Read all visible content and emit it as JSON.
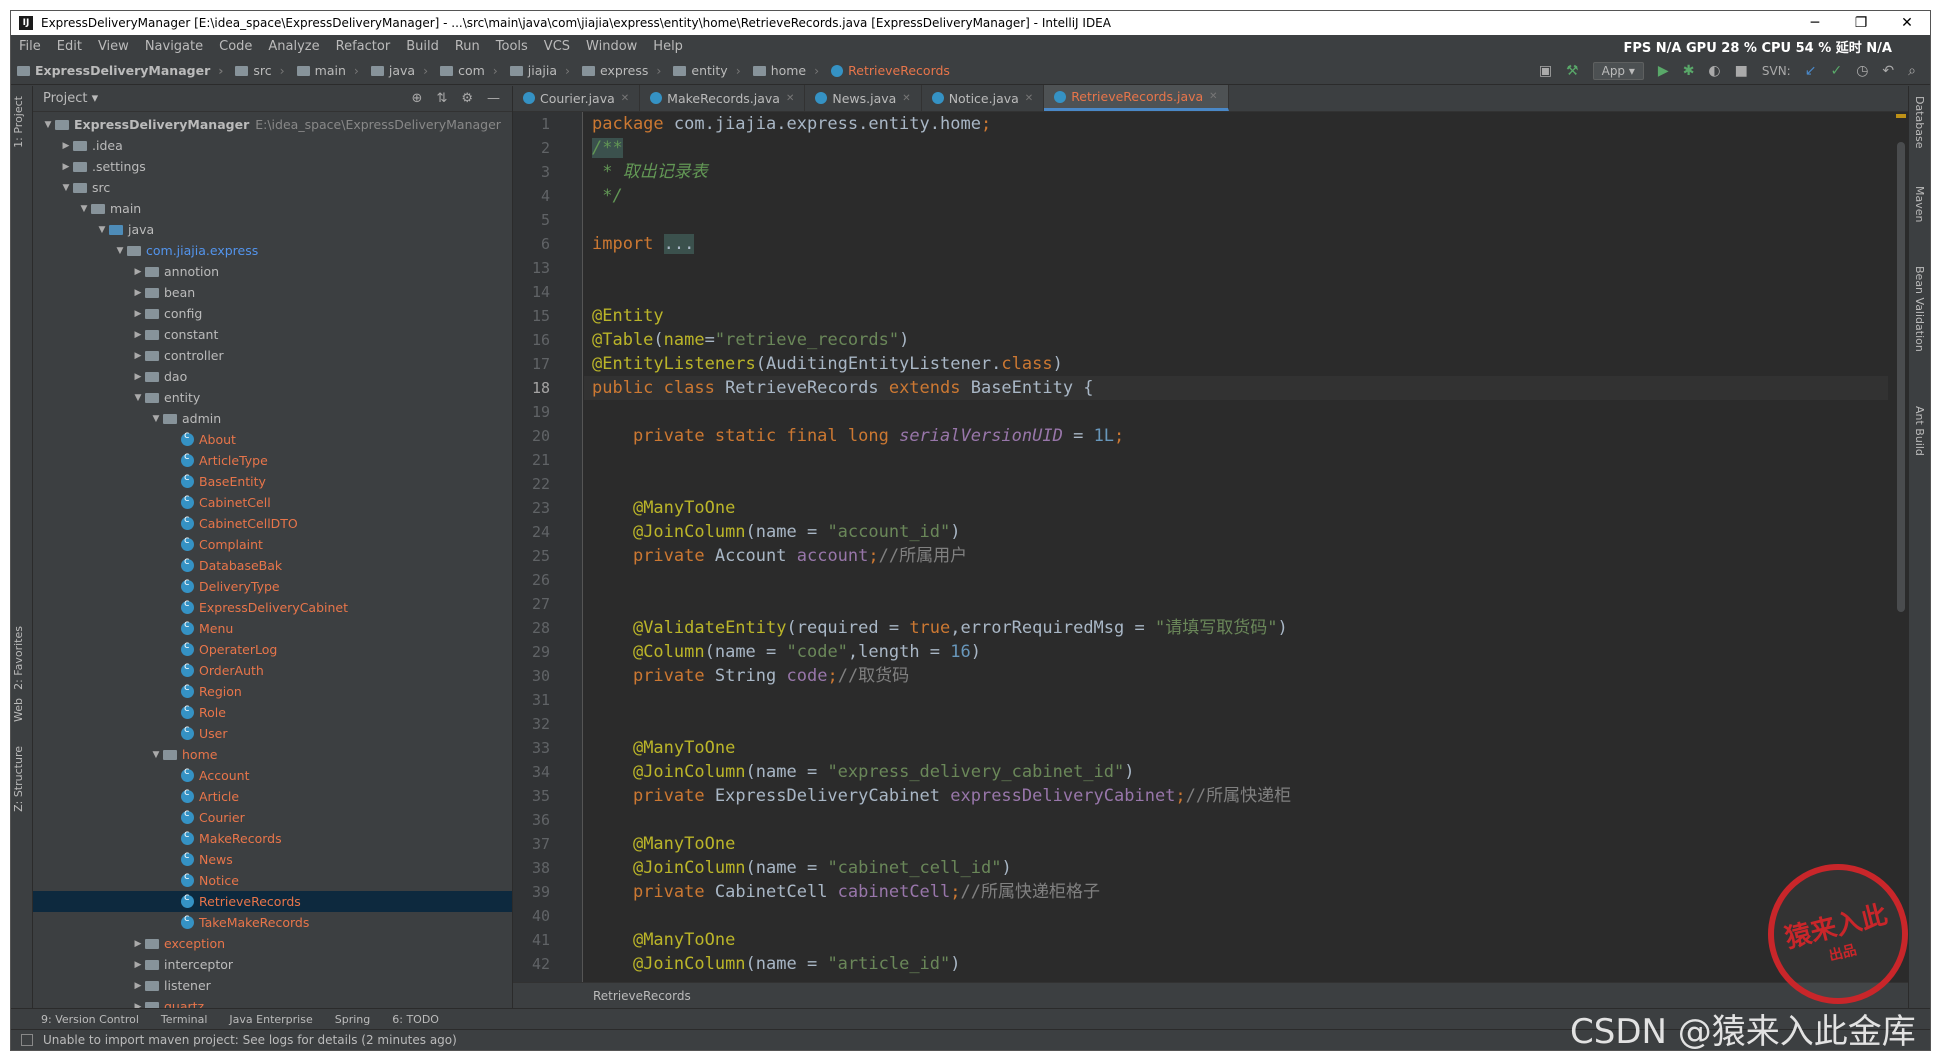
{
  "title_bar": {
    "title": "ExpressDeliveryManager [E:\\idea_space\\ExpressDeliveryManager] - ...\\src\\main\\java\\com\\jiajia\\express\\entity\\home\\RetrieveRecords.java [ExpressDeliveryManager] - IntelliJ IDEA",
    "minimize": "─",
    "maximize": "❐",
    "close": "✕"
  },
  "menu": [
    "File",
    "Edit",
    "View",
    "Navigate",
    "Code",
    "Analyze",
    "Refactor",
    "Build",
    "Run",
    "Tools",
    "VCS",
    "Window",
    "Help"
  ],
  "perf_overlay": "FPS N/A GPU 28 % CPU 54 % 延时 N/A",
  "nav": {
    "crumbs": [
      "ExpressDeliveryManager",
      "src",
      "main",
      "java",
      "com",
      "jiajia",
      "express",
      "entity",
      "home"
    ],
    "active_crumb": "RetrieveRecords",
    "run_config": "App",
    "svn_label": "SVN:"
  },
  "left_strip": {
    "project": "1: Project",
    "favorites": "2: Favorites",
    "web": "Web",
    "structure": "Z: Structure"
  },
  "right_strip": {
    "database": "Database",
    "maven": "Maven",
    "bean_validation": "Bean Validation",
    "ant_build": "Ant Build"
  },
  "project_panel": {
    "header": "Project",
    "tree": [
      {
        "depth": 0,
        "type": "folder",
        "label": "ExpressDeliveryManager",
        "hint": "E:\\idea_space\\ExpressDeliveryManager",
        "open": true,
        "bold": true
      },
      {
        "depth": 1,
        "type": "folder",
        "label": ".idea",
        "open": false
      },
      {
        "depth": 1,
        "type": "folder",
        "label": ".settings",
        "open": false
      },
      {
        "depth": 1,
        "type": "folder",
        "label": "src",
        "open": true
      },
      {
        "depth": 2,
        "type": "folder",
        "label": "main",
        "open": true
      },
      {
        "depth": 3,
        "type": "srcfolder",
        "label": "java",
        "open": true
      },
      {
        "depth": 4,
        "type": "folder",
        "label": "com.jiajia.express",
        "open": true,
        "color": "blue"
      },
      {
        "depth": 5,
        "type": "folder",
        "label": "annotion",
        "open": false
      },
      {
        "depth": 5,
        "type": "folder",
        "label": "bean",
        "open": false
      },
      {
        "depth": 5,
        "type": "folder",
        "label": "config",
        "open": false
      },
      {
        "depth": 5,
        "type": "folder",
        "label": "constant",
        "open": false
      },
      {
        "depth": 5,
        "type": "folder",
        "label": "controller",
        "open": false
      },
      {
        "depth": 5,
        "type": "folder",
        "label": "dao",
        "open": false
      },
      {
        "depth": 5,
        "type": "folder",
        "label": "entity",
        "open": true
      },
      {
        "depth": 6,
        "type": "folder",
        "label": "admin",
        "open": true
      },
      {
        "depth": 7,
        "type": "class",
        "label": "About"
      },
      {
        "depth": 7,
        "type": "class",
        "label": "ArticleType"
      },
      {
        "depth": 7,
        "type": "class",
        "label": "BaseEntity"
      },
      {
        "depth": 7,
        "type": "class",
        "label": "CabinetCell"
      },
      {
        "depth": 7,
        "type": "class",
        "label": "CabinetCellDTO"
      },
      {
        "depth": 7,
        "type": "class",
        "label": "Complaint"
      },
      {
        "depth": 7,
        "type": "class",
        "label": "DatabaseBak"
      },
      {
        "depth": 7,
        "type": "class",
        "label": "DeliveryType"
      },
      {
        "depth": 7,
        "type": "class",
        "label": "ExpressDeliveryCabinet"
      },
      {
        "depth": 7,
        "type": "class",
        "label": "Menu"
      },
      {
        "depth": 7,
        "type": "class",
        "label": "OperaterLog"
      },
      {
        "depth": 7,
        "type": "class",
        "label": "OrderAuth"
      },
      {
        "depth": 7,
        "type": "class",
        "label": "Region"
      },
      {
        "depth": 7,
        "type": "class",
        "label": "Role"
      },
      {
        "depth": 7,
        "type": "class",
        "label": "User"
      },
      {
        "depth": 6,
        "type": "folder",
        "label": "home",
        "open": true,
        "color": "orange"
      },
      {
        "depth": 7,
        "type": "class",
        "label": "Account"
      },
      {
        "depth": 7,
        "type": "class",
        "label": "Article"
      },
      {
        "depth": 7,
        "type": "class",
        "label": "Courier"
      },
      {
        "depth": 7,
        "type": "class",
        "label": "MakeRecords"
      },
      {
        "depth": 7,
        "type": "class",
        "label": "News"
      },
      {
        "depth": 7,
        "type": "class",
        "label": "Notice"
      },
      {
        "depth": 7,
        "type": "class",
        "label": "RetrieveRecords",
        "selected": true
      },
      {
        "depth": 7,
        "type": "class",
        "label": "TakeMakeRecords"
      },
      {
        "depth": 5,
        "type": "folder",
        "label": "exception",
        "open": false,
        "color": "orange"
      },
      {
        "depth": 5,
        "type": "folder",
        "label": "interceptor",
        "open": false
      },
      {
        "depth": 5,
        "type": "folder",
        "label": "listener",
        "open": false
      },
      {
        "depth": 5,
        "type": "folder",
        "label": "quartz",
        "open": false,
        "color": "orange"
      }
    ]
  },
  "editor": {
    "tabs": [
      {
        "label": "Courier.java",
        "active": false
      },
      {
        "label": "MakeRecords.java",
        "active": false
      },
      {
        "label": "News.java",
        "active": false
      },
      {
        "label": "Notice.java",
        "active": false
      },
      {
        "label": "RetrieveRecords.java",
        "active": true
      }
    ],
    "lines": [
      {
        "n": "1",
        "html": "<span class='kw'>package</span> com.jiajia.express.entity.home<span class='kw'>;</span>"
      },
      {
        "n": "2",
        "html": "<span class='doc fold'>/**</span>"
      },
      {
        "n": "3",
        "html": "<span class='doc'> * 取出记录表</span>"
      },
      {
        "n": "4",
        "html": "<span class='doc'> */</span>"
      },
      {
        "n": "5",
        "html": ""
      },
      {
        "n": "6",
        "html": "<span class='kw'>import</span> <span class='fold'>...</span>"
      },
      {
        "n": "13",
        "html": ""
      },
      {
        "n": "14",
        "html": ""
      },
      {
        "n": "15",
        "html": "<span class='ann'>@Entity</span>"
      },
      {
        "n": "16",
        "html": "<span class='ann'>@Table</span>(<span class='ann'>name</span>=<span class='str'>\"retrieve_records\"</span>)"
      },
      {
        "n": "17",
        "html": "<span class='ann'>@EntityListeners</span>(AuditingEntityListener.<span class='kw'>class</span>)"
      },
      {
        "n": "18",
        "html": "<span class='kw'>public class</span> RetrieveRecords <span class='kw'>extends</span> BaseEntity {",
        "cur": true
      },
      {
        "n": "19",
        "html": ""
      },
      {
        "n": "20",
        "html": "    <span class='kw'>private static final long</span> <span class='sfld'>serialVersionUID</span> = <span class='num'>1L</span><span class='kw'>;</span>"
      },
      {
        "n": "21",
        "html": ""
      },
      {
        "n": "22",
        "html": ""
      },
      {
        "n": "23",
        "html": "    <span class='ann'>@ManyToOne</span>"
      },
      {
        "n": "24",
        "html": "    <span class='ann'>@JoinColumn</span>(name = <span class='str'>\"account_id\"</span>)"
      },
      {
        "n": "25",
        "html": "    <span class='kw'>private</span> Account <span class='fld'>account</span><span class='kw'>;</span><span class='cmt'>//所属用户</span>"
      },
      {
        "n": "26",
        "html": ""
      },
      {
        "n": "27",
        "html": ""
      },
      {
        "n": "28",
        "html": "    <span class='ann'>@ValidateEntity</span>(required = <span class='kw'>true</span>,errorRequiredMsg = <span class='str'>\"请填写取货码\"</span>)"
      },
      {
        "n": "29",
        "html": "    <span class='ann'>@Column</span>(name = <span class='str'>\"code\"</span>,length = <span class='num'>16</span>)"
      },
      {
        "n": "30",
        "html": "    <span class='kw'>private</span> String <span class='fld'>code</span><span class='kw'>;</span><span class='cmt'>//取货码</span>"
      },
      {
        "n": "31",
        "html": ""
      },
      {
        "n": "32",
        "html": ""
      },
      {
        "n": "33",
        "html": "    <span class='ann'>@ManyToOne</span>"
      },
      {
        "n": "34",
        "html": "    <span class='ann'>@JoinColumn</span>(name = <span class='str'>\"express_delivery_cabinet_id\"</span>)"
      },
      {
        "n": "35",
        "html": "    <span class='kw'>private</span> ExpressDeliveryCabinet <span class='fld'>expressDeliveryCabinet</span><span class='kw'>;</span><span class='cmt'>//所属快递柜</span>"
      },
      {
        "n": "36",
        "html": ""
      },
      {
        "n": "37",
        "html": "    <span class='ann'>@ManyToOne</span>"
      },
      {
        "n": "38",
        "html": "    <span class='ann'>@JoinColumn</span>(name = <span class='str'>\"cabinet_cell_id\"</span>)"
      },
      {
        "n": "39",
        "html": "    <span class='kw'>private</span> CabinetCell <span class='fld'>cabinetCell</span><span class='kw'>;</span><span class='cmt'>//所属快递柜格子</span>"
      },
      {
        "n": "40",
        "html": ""
      },
      {
        "n": "41",
        "html": "    <span class='ann'>@ManyToOne</span>"
      },
      {
        "n": "42",
        "html": "    <span class='ann'>@JoinColumn</span>(name = <span class='str'>\"article_id\"</span>)"
      }
    ],
    "breadcrumb": "RetrieveRecords"
  },
  "tool_windows": [
    "9: Version Control",
    "Terminal",
    "Java Enterprise",
    "Spring",
    "6: TODO"
  ],
  "status": {
    "message": "Unable to import maven project: See logs for details (2 minutes ago)"
  },
  "stamp": {
    "line1": "猿来入此",
    "line2": "出品"
  },
  "watermark": "CSDN @猿来入此金库"
}
